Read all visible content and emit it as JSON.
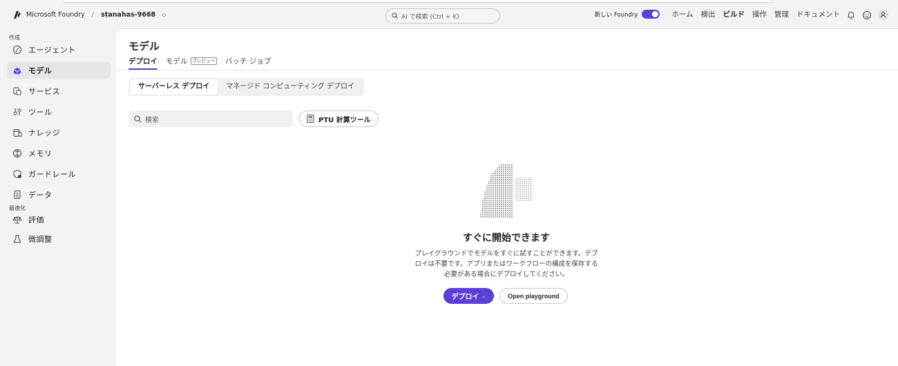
{
  "header": {
    "brand": "Microsoft Foundry",
    "separator": "/",
    "project": "stanahas-9668",
    "project_chevron": "◇",
    "search_placeholder": "AI で検索 (Ctrl + K)",
    "toggle_label": "新しい Foundry",
    "toggle_on": true,
    "nav": [
      {
        "label": "ホーム",
        "active": false
      },
      {
        "label": "検出",
        "active": false
      },
      {
        "label": "ビルド",
        "active": true
      },
      {
        "label": "操作",
        "active": false
      },
      {
        "label": "管理",
        "active": false
      },
      {
        "label": "ドキュメント",
        "active": false
      }
    ],
    "icons": [
      "bell-icon",
      "smiley-icon",
      "user-icon"
    ]
  },
  "sidebar": {
    "section_create": "作成",
    "section_optimize": "最適化",
    "create_items": [
      {
        "label": "エージェント",
        "icon": "agent-icon",
        "active": false
      },
      {
        "label": "モデル",
        "icon": "model-icon",
        "active": true
      },
      {
        "label": "サービス",
        "icon": "service-icon",
        "active": false
      },
      {
        "label": "ツール",
        "icon": "tools-icon",
        "active": false
      },
      {
        "label": "ナレッジ",
        "icon": "knowledge-icon",
        "active": false
      },
      {
        "label": "メモリ",
        "icon": "memory-icon",
        "active": false
      },
      {
        "label": "ガードレール",
        "icon": "guardrail-icon",
        "active": false
      },
      {
        "label": "データ",
        "icon": "data-icon",
        "active": false
      }
    ],
    "optimize_items": [
      {
        "label": "評価",
        "icon": "evaluation-icon",
        "active": false
      },
      {
        "label": "微調整",
        "icon": "finetune-icon",
        "active": false
      }
    ]
  },
  "main": {
    "title": "モデル",
    "tabs": [
      {
        "label": "デプロイ",
        "active": true
      },
      {
        "label": "モデル",
        "badge": "プレビュー",
        "active": false
      },
      {
        "label": "バッチ ジョブ",
        "active": false
      }
    ],
    "segments": [
      {
        "label": "サーバーレス デプロイ",
        "active": true
      },
      {
        "label": "マネージド コンピューティング デプロイ",
        "active": false
      }
    ],
    "search_placeholder": "検索",
    "ptu_button": "PTU 計算ツール",
    "empty": {
      "title": "すぐに開始できます",
      "description_lines": [
        "プレイグラウンドでモデルをすぐに試すことができます。デプ",
        "ロイは不要です。アプリまたはワークフローの構成を保存する",
        "必要がある場合にデプロイしてください。"
      ],
      "deploy_button": "デプロイ",
      "deploy_chevron": "⌄",
      "playground_button": "Open playground"
    }
  },
  "colors": {
    "accent": "#5b3fd6",
    "background": "#f3f3f3",
    "surface": "#ffffff"
  }
}
